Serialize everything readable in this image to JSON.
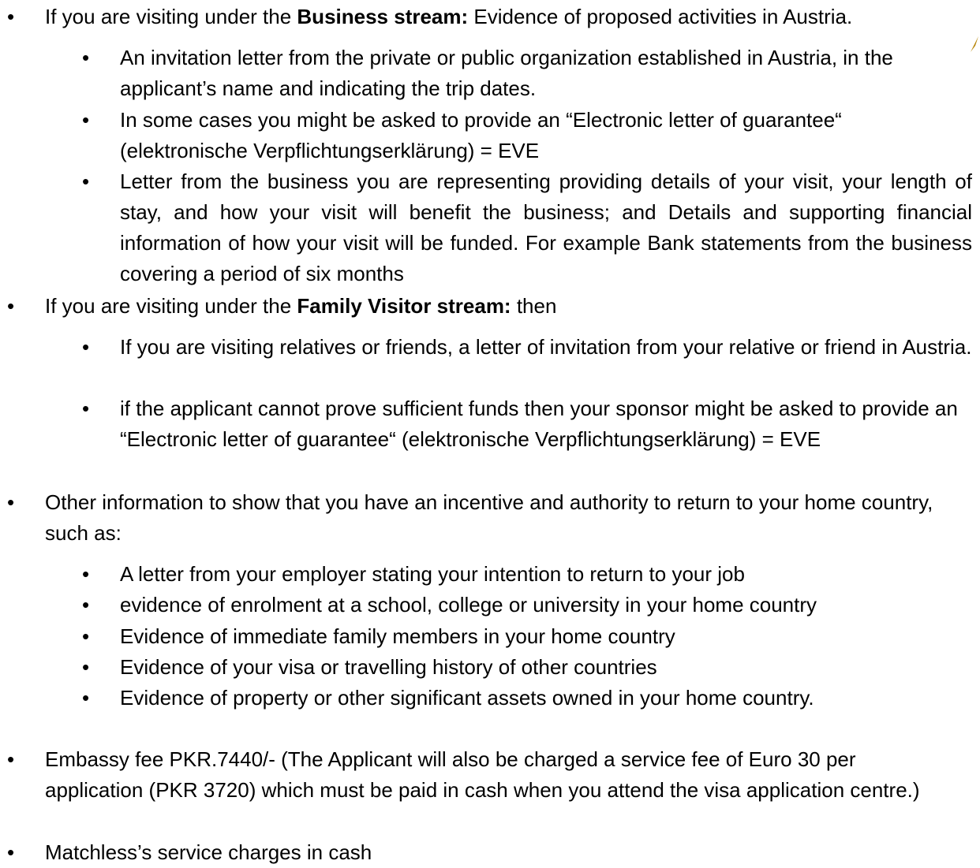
{
  "items": [
    {
      "pre": "If you are visiting under the ",
      "bold": "Business stream:",
      "post": " Evidence of proposed activities in Austria."
    },
    {
      "text": "An invitation letter from the private or public organization established in Austria, in the applicant’s name and indicating the trip dates."
    },
    {
      "text": "In some cases you might be asked to provide an “Electronic letter of guarantee“ (elektronische Verpflichtungserklärung) = EVE"
    },
    {
      "text": "Letter from the business you are representing providing details of your visit, your length of stay, and how your visit will benefit the business; and Details and supporting financial information of how your visit will be funded. For example Bank statements from the business covering a period of six months"
    },
    {
      "pre": "If you are visiting under the ",
      "bold": "Family Visitor stream:",
      "post": " then"
    },
    {
      "text": "If you are visiting relatives or friends, a letter of invitation from your relative or friend in Austria."
    },
    {
      "text": "if the applicant cannot prove sufficient funds then  your sponsor might be asked to provide an “Electronic letter of guarantee“ (elektronische Verpflichtungserklärung) = EVE"
    },
    {
      "text": "Other information to show that you have an incentive and authority to return to your home country, such as:"
    },
    {
      "text": "A letter from your employer stating your intention to return to your job"
    },
    {
      "text": "evidence of enrolment at a school, college or university in your home country"
    },
    {
      "text": "Evidence of immediate family members in your home country"
    },
    {
      "text": "Evidence of your visa or travelling history of other countries"
    },
    {
      "text": "Evidence of property or other significant assets owned in your home country."
    },
    {
      "text": "Embassy fee PKR.7440/- (The Applicant will also be charged a service fee of Euro 30 per application (PKR 3720) which must be paid in cash when you attend the visa application centre.)"
    },
    {
      "text": "Matchless’s service charges in cash"
    }
  ],
  "bullet_glyph": "•",
  "accent_color": "#b8860b"
}
